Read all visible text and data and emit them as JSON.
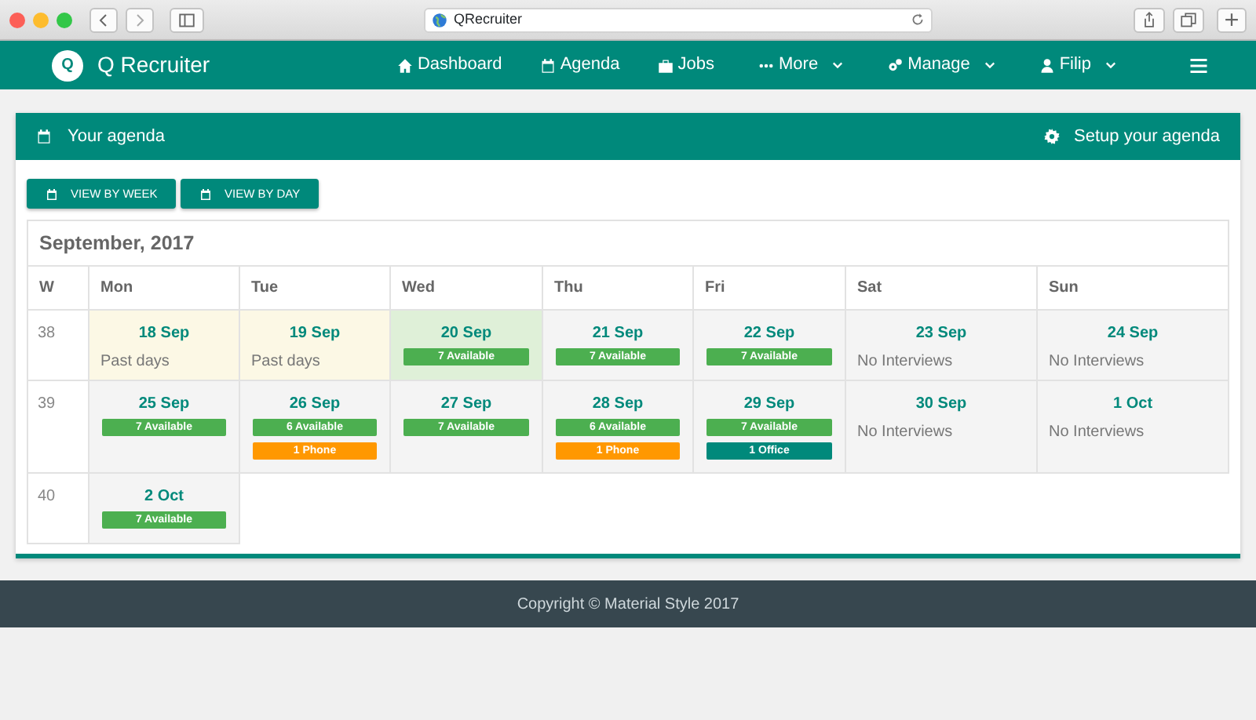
{
  "browser": {
    "address": "QRecruiter"
  },
  "navbar": {
    "logo_letter": "Q",
    "brand": "Q Recruiter",
    "items": [
      {
        "label": "Dashboard",
        "kind": "home",
        "dropdown": false
      },
      {
        "label": "Agenda",
        "kind": "calendar",
        "dropdown": false
      },
      {
        "label": "Jobs",
        "kind": "briefcase",
        "dropdown": false
      },
      {
        "label": "More",
        "kind": "dots",
        "dropdown": true
      },
      {
        "label": "Manage",
        "kind": "gears",
        "dropdown": true
      },
      {
        "label": "Filip",
        "kind": "user",
        "dropdown": true
      }
    ]
  },
  "agenda": {
    "title": "Your agenda",
    "setup": "Setup your agenda",
    "buttons": [
      "VIEW BY WEEK",
      "VIEW BY DAY"
    ],
    "month": "September, 2017",
    "columns": [
      "W",
      "Mon",
      "Tue",
      "Wed",
      "Thu",
      "Fri",
      "Sat",
      "Sun"
    ],
    "weeks": [
      {
        "week": "38",
        "days": [
          {
            "date": "18 Sep",
            "kind": "past",
            "note": "Past days"
          },
          {
            "date": "19 Sep",
            "kind": "past",
            "note": "Past days"
          },
          {
            "date": "20 Sep",
            "kind": "today",
            "badges": [
              {
                "label": "7 Available",
                "color": "#4caf50"
              }
            ]
          },
          {
            "date": "21 Sep",
            "kind": "normal",
            "badges": [
              {
                "label": "7 Available",
                "color": "#4caf50"
              }
            ]
          },
          {
            "date": "22 Sep",
            "kind": "normal",
            "badges": [
              {
                "label": "7 Available",
                "color": "#4caf50"
              }
            ]
          },
          {
            "date": "23 Sep",
            "kind": "normal",
            "note": "No Interviews"
          },
          {
            "date": "24 Sep",
            "kind": "normal",
            "note": "No Interviews"
          }
        ]
      },
      {
        "week": "39",
        "days": [
          {
            "date": "25 Sep",
            "kind": "normal",
            "badges": [
              {
                "label": "7 Available",
                "color": "#4caf50"
              }
            ]
          },
          {
            "date": "26 Sep",
            "kind": "normal",
            "badges": [
              {
                "label": "6 Available",
                "color": "#4caf50"
              },
              {
                "label": "1 Phone",
                "color": "#ff9800"
              }
            ]
          },
          {
            "date": "27 Sep",
            "kind": "normal",
            "badges": [
              {
                "label": "7 Available",
                "color": "#4caf50"
              }
            ]
          },
          {
            "date": "28 Sep",
            "kind": "normal",
            "badges": [
              {
                "label": "6 Available",
                "color": "#4caf50"
              },
              {
                "label": "1 Phone",
                "color": "#ff9800"
              }
            ]
          },
          {
            "date": "29 Sep",
            "kind": "normal",
            "badges": [
              {
                "label": "7 Available",
                "color": "#4caf50"
              },
              {
                "label": "1 Office",
                "color": "#00897b"
              }
            ]
          },
          {
            "date": "30 Sep",
            "kind": "normal",
            "note": "No Interviews"
          },
          {
            "date": "1 Oct",
            "kind": "normal",
            "note": "No Interviews"
          }
        ]
      },
      {
        "week": "40",
        "days": [
          {
            "date": "2 Oct",
            "kind": "normal",
            "badges": [
              {
                "label": "7 Available",
                "color": "#4caf50"
              }
            ]
          }
        ]
      }
    ]
  },
  "footer": "Copyright © Material Style 2017"
}
